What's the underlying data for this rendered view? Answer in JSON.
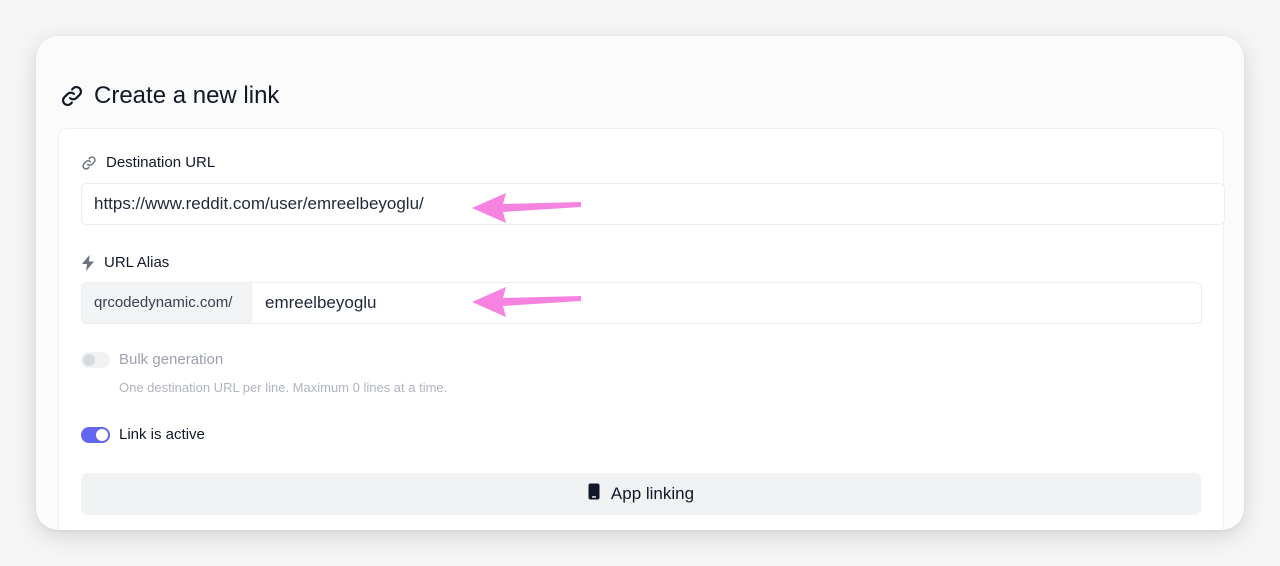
{
  "header": {
    "title": "Create a new link",
    "icon": "link-icon"
  },
  "destination": {
    "label": "Destination URL",
    "icon": "link-icon",
    "value": "https://www.reddit.com/user/emreelbeyoglu/"
  },
  "alias": {
    "label": "URL Alias",
    "icon": "bolt-icon",
    "prefix": "qrcodedynamic.com/",
    "value": "emreelbeyoglu"
  },
  "bulk": {
    "label": "Bulk generation",
    "help": "One destination URL per line. Maximum 0 lines at a time.",
    "enabled": false
  },
  "active": {
    "label": "Link is active",
    "enabled": true
  },
  "app_linking": {
    "label": "App linking",
    "icon": "mobile-phone-icon"
  },
  "colors": {
    "accent": "#6366f1",
    "annotation_arrow": "#f783e0"
  }
}
